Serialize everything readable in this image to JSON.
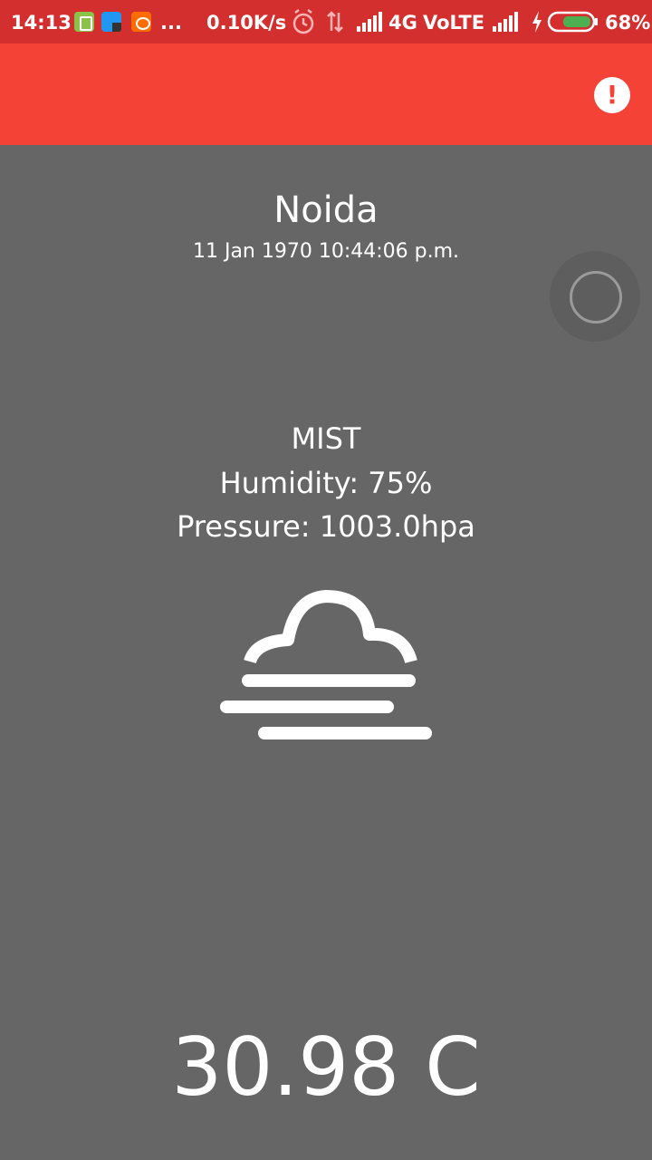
{
  "status_bar": {
    "time": "14:13",
    "more": "...",
    "net_speed": "0.10K/s",
    "network": "4G",
    "volte": "VoLTE",
    "battery": "68%"
  },
  "weather": {
    "city": "Noida",
    "datetime": "11 Jan 1970 10:44:06 p.m.",
    "description": "MIST",
    "humidity": "Humidity: 75%",
    "pressure": "Pressure: 1003.0hpa",
    "temperature": "30.98 C",
    "icon": "mist-icon"
  },
  "colors": {
    "status_bar": "#d32f2f",
    "app_bar": "#f44336",
    "background": "#666666",
    "text": "#ffffff",
    "battery_fill": "#4caf50"
  },
  "icons": {
    "alert": "alert-icon",
    "refresh": "refresh-icon"
  }
}
